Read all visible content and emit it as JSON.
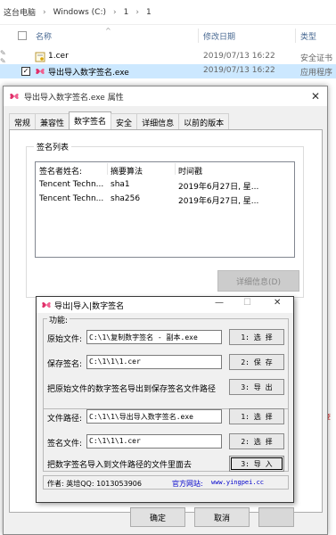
{
  "explorer": {
    "breadcrumb": [
      "这台电脑",
      "Windows (C:)",
      "1",
      "1"
    ],
    "columns": {
      "name": "名称",
      "date": "修改日期",
      "type": "类型"
    },
    "files": [
      {
        "name": "1.cer",
        "date": "2019/07/13 16:22",
        "type": "安全证书"
      },
      {
        "name": "导出导入数字签名.exe",
        "date": "2019/07/13 16:22",
        "type": "应用程序"
      }
    ],
    "edge_text": "查"
  },
  "properties": {
    "title": "导出导入数字签名.exe 属性",
    "tabs": [
      "常规",
      "兼容性",
      "数字签名",
      "安全",
      "详细信息",
      "以前的版本"
    ],
    "active_tab": "数字签名",
    "signature_list_label": "签名列表",
    "list_headers": [
      "签名者姓名:",
      "摘要算法",
      "时间戳"
    ],
    "rows": [
      {
        "signer": "Tencent Techn...",
        "digest": "sha1",
        "timestamp": "2019年6月27日, 星..."
      },
      {
        "signer": "Tencent Techn...",
        "digest": "sha256",
        "timestamp": "2019年6月27日, 星..."
      }
    ],
    "details_button": "详细信息(D)",
    "ok_button": "确定",
    "cancel_button": "取消"
  },
  "tool": {
    "title": "导出|导入|数字签名",
    "group_label": "功能:",
    "export": {
      "source_label": "原始文件:",
      "source_value": "C:\\1\\复制数字签名 - 副本.exe",
      "select_button": "1: 选 择",
      "save_label": "保存签名:",
      "save_value": "C:\\1\\1\\1.cer",
      "save_button": "2: 保 存",
      "description": "把原始文件的数字签名导出到保存签名文件路径",
      "export_button": "3: 导 出"
    },
    "import": {
      "path_label": "文件路径:",
      "path_value": "C:\\1\\1\\导出导入数字签名.exe",
      "select_button": "1: 选 择",
      "sig_label": "签名文件:",
      "sig_value": "C:\\1\\1\\1.cer",
      "sig_button": "2: 选 择",
      "description": "把数字签名导入到文件路径的文件里面去",
      "import_button": "3: 导 入"
    },
    "author": "作者: 英培QQ: 1013053906",
    "site_label": "官方网站:",
    "site_url": "www.yingpei.cc"
  }
}
